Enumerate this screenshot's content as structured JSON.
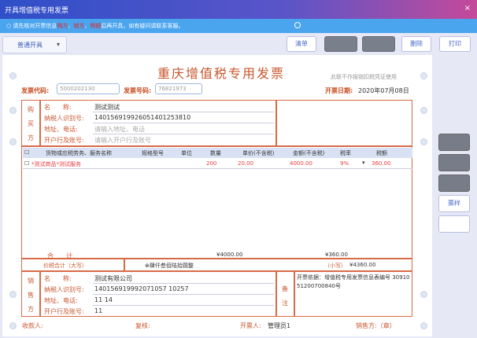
{
  "window": {
    "title": "开具增值税专用发票",
    "close": "×"
  },
  "notice": {
    "pre": "请先核对开票信息",
    "red1": "购方",
    "mid1": "、",
    "red2": "销方",
    "mid2": "",
    "red3": "明细",
    "post": "后再开具，如有疑问请联系客服。"
  },
  "toolbar": {
    "dropdown": "普通开具",
    "buttons": [
      "清单",
      "",
      "",
      "删除",
      "打印"
    ]
  },
  "side_buttons": [
    "",
    "",
    "",
    "票样",
    ""
  ],
  "invoice": {
    "title": "重庆增值税专用发票",
    "note_top": "此联不作报销扣税凭证使用",
    "code_label": "发票代码:",
    "code_value": "5000202130",
    "number_label": "发票号码:",
    "number_value": "76821973",
    "date_label": "开票日期:",
    "date_value": "2020年07月08日",
    "buyer": {
      "section": [
        "购",
        "买",
        "方"
      ],
      "name_label": "名　　称:",
      "name": "测试测试",
      "taxid_label": "纳税人识别号:",
      "taxid": "140156919926051401253810",
      "addr_label": "地址、电话:",
      "addr": "请输入地址、电话",
      "bank_label": "开户行及账号:",
      "bank": "请输入开户行及账号"
    },
    "columns": [
      "货物或应税劳务、服务名称",
      "规格型号",
      "单位",
      "数量",
      "单价(不含税)",
      "金额(不含税)",
      "税率",
      "税额"
    ],
    "rows": [
      {
        "name": "*测试商品*测试服务",
        "spec": "",
        "unit": "",
        "qty": "200",
        "price": "20.00",
        "amount": "4000.00",
        "rate": "9%",
        "tax": "360.00"
      }
    ],
    "total_label": "合　　计",
    "total_amount": "¥4000.00",
    "total_tax": "¥360.00",
    "grand_label": "价税合计（大写）",
    "grand_upper": "⊗肆仟叁佰陆拾圆整",
    "grand_small_label": "（小写）",
    "grand_small": "¥4360.00",
    "seller": {
      "section": [
        "销",
        "售",
        "方"
      ],
      "name_label": "名　　称:",
      "name": "测试有限公司",
      "taxid_label": "纳税人识别号:",
      "taxid": "140156919992071057 10257",
      "addr_label": "地址、电话:",
      "addr": "11 14",
      "bank_label": "开户行及账号:",
      "bank": "11"
    },
    "remark_label": [
      "备",
      "注"
    ],
    "remark": "开票依据：增值税专用发票信息表编号 3091051200700840号",
    "payee_label": "收款人:",
    "review_label": "复核:",
    "drawer_label": "开票人:",
    "drawer": "管理员1",
    "seal_label": "销售方:（章）"
  }
}
